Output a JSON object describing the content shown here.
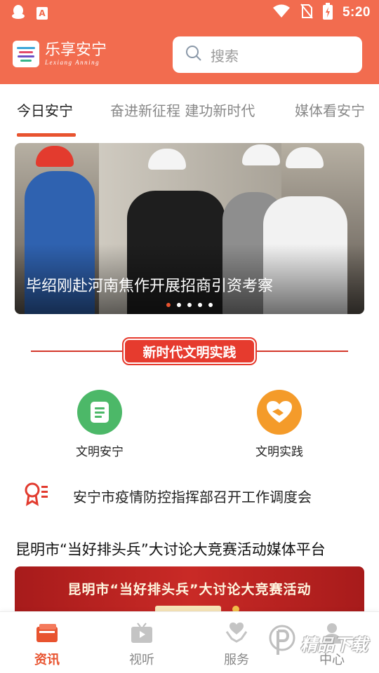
{
  "status_bar": {
    "time": "5:20",
    "left_icons": [
      "qq-penguin-icon",
      "app-a-icon"
    ],
    "app_icon_letter": "A",
    "right_icons": [
      "wifi-icon",
      "no-sim-icon",
      "battery-charging-icon"
    ]
  },
  "header": {
    "app_name": "乐享安宁",
    "app_name_en": "Lexiang Anning",
    "search_placeholder": "搜索"
  },
  "tabs": [
    {
      "label": "今日安宁",
      "active": true
    },
    {
      "label": "奋进新征程 建功新时代",
      "active": false
    },
    {
      "label": "媒体看安宁",
      "active": false
    }
  ],
  "banner": {
    "caption": "毕绍刚赴河南焦作开展招商引资考察",
    "slide_count": 5,
    "active_slide": 1
  },
  "section": {
    "title": "新时代文明实践"
  },
  "features": [
    {
      "label": "文明安宁",
      "icon": "document-icon",
      "color": "#4cb868"
    },
    {
      "label": "文明实践",
      "icon": "handshake-heart-icon",
      "color": "#f49b2a"
    }
  ],
  "notice": {
    "icon": "ribbon-badge-icon",
    "text": "安宁市疫情防控指挥部召开工作调度会"
  },
  "headline": "昆明市“当好排头兵”大讨论大竞赛活动媒体平台",
  "promo": {
    "text": "昆明市“当好排头兵”大讨论大竞赛活动"
  },
  "bottom_nav": [
    {
      "label": "资讯",
      "icon": "news-icon",
      "active": true
    },
    {
      "label": "视听",
      "icon": "tv-play-icon",
      "active": false
    },
    {
      "label": "服务",
      "icon": "heart-hands-icon",
      "active": false
    },
    {
      "label": "中心",
      "icon": "person-icon",
      "active": false
    }
  ],
  "watermark": {
    "text": "精品下载"
  },
  "colors": {
    "brand": "#f26c4f",
    "accent": "#e8532f",
    "section_red": "#e63b2e"
  }
}
